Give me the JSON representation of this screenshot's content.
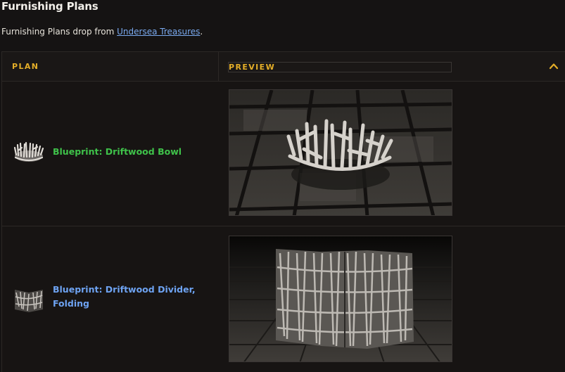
{
  "section": {
    "title": "Furnishing Plans",
    "intro_prefix": "Furnishing Plans drop from ",
    "intro_link": "Undersea Treasures",
    "intro_suffix": "."
  },
  "table": {
    "headers": {
      "plan": "PLAN",
      "preview": "PREVIEW"
    },
    "toggle_icon": "chevron-up-icon",
    "rows": [
      {
        "plan_name": "Blueprint: Driftwood Bowl",
        "name_color": "#3fc24a",
        "icon": "driftwood-bowl-icon",
        "preview": "driftwood-bowl-preview"
      },
      {
        "plan_name": "Blueprint: Driftwood Divider, Folding",
        "name_color": "#6ea3f2",
        "icon": "driftwood-divider-icon",
        "preview": "driftwood-divider-preview"
      }
    ]
  },
  "colors": {
    "background": "#151313",
    "header_accent": "#e4ae28",
    "link": "#7aaaf0"
  }
}
